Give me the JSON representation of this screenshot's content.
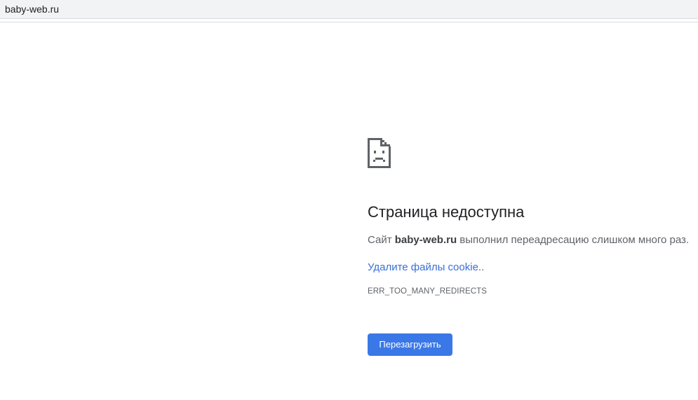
{
  "browser": {
    "url": "baby-web.ru"
  },
  "error_page": {
    "icon": "sad-page-icon",
    "title": "Страница недоступна",
    "summary_prefix": "Сайт",
    "summary_host": "baby-web.ru",
    "summary_suffix": "выполнил переадресацию слишком много раз.",
    "suggestion_link": "Удалите файлы cookie",
    "suggestion_suffix": "..",
    "error_code": "ERR_TOO_MANY_REDIRECTS",
    "reload_label": "Перезагрузить"
  },
  "colors": {
    "accent": "#3b78e7",
    "link": "#3a6fd6",
    "address_bar_bg": "#f1f3f4"
  }
}
